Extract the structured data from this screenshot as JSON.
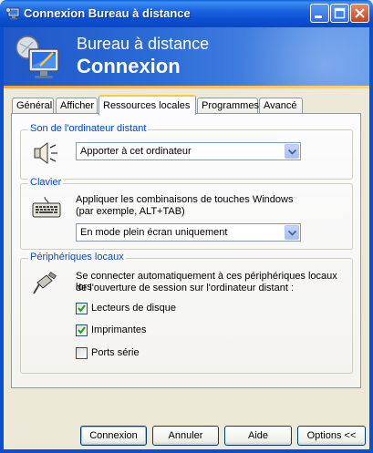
{
  "window": {
    "title": "Connexion Bureau à distance",
    "controls": [
      "minimize",
      "maximize",
      "close"
    ]
  },
  "banner": {
    "line1": "Bureau à distance",
    "line2": "Connexion"
  },
  "tabs": [
    {
      "label": "Général",
      "active": false
    },
    {
      "label": "Afficher",
      "active": false
    },
    {
      "label": "Ressources locales",
      "active": true
    },
    {
      "label": "Programmes",
      "active": false
    },
    {
      "label": "Avancé",
      "active": false
    }
  ],
  "sound": {
    "legend": "Son de l'ordinateur distant",
    "icon": "speaker-icon",
    "selected": "Apporter à cet ordinateur"
  },
  "keyboard": {
    "legend": "Clavier",
    "icon": "keyboard-icon",
    "description_line1": "Appliquer les combinaisons de touches Windows",
    "description_line2": "(par exemple, ALT+TAB)",
    "selected": "En mode plein écran uniquement"
  },
  "devices": {
    "legend": "Périphériques locaux",
    "icon": "plug-icon",
    "description_line1": "Se connecter automatiquement à ces périphériques locaux lors",
    "description_line2": "de l'ouverture de session sur l'ordinateur distant :",
    "items": [
      {
        "label": "Lecteurs de disque",
        "checked": true
      },
      {
        "label": "Imprimantes",
        "checked": true
      },
      {
        "label": "Ports série",
        "checked": false
      }
    ]
  },
  "buttons": {
    "connect": "Connexion",
    "cancel": "Annuler",
    "help": "Aide",
    "options": "Options <<"
  },
  "colors": {
    "titlebar": "#0b4fd1",
    "legend": "#0046d5",
    "tab_highlight": "#ffc83c"
  }
}
